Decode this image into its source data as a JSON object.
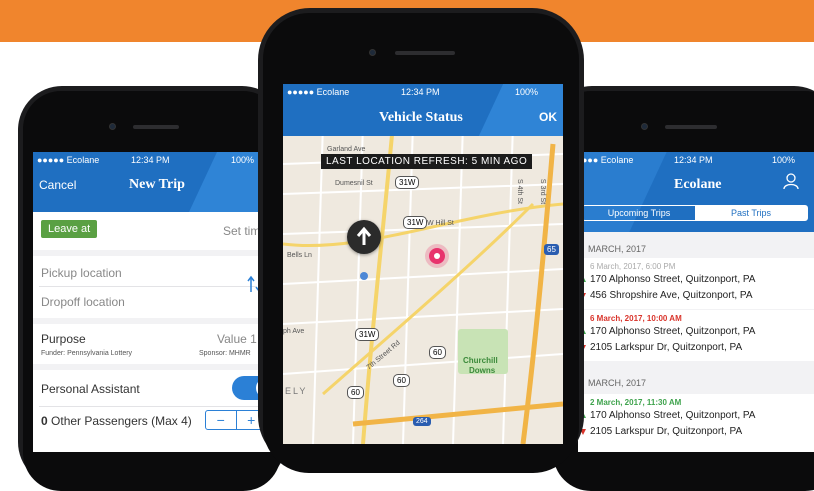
{
  "colors": {
    "banner": "#f0852d",
    "navbar": "#1f6fc1",
    "accent_green": "#5aa043",
    "toggle": "#2b80d6",
    "date_red": "#d9342b",
    "date_green": "#3fa34d"
  },
  "left_phone": {
    "status": {
      "carrier": "●●●●● Ecolane",
      "time": "12:34 PM",
      "battery": "100%"
    },
    "nav": {
      "cancel": "Cancel",
      "title": "New Trip"
    },
    "leave_at": "Leave at",
    "set_time": "Set time",
    "pickup": "Pickup location",
    "dropoff": "Dropoff location",
    "purpose_label": "Purpose",
    "purpose_value": "Value 1",
    "funder": "Funder: Pennsylvania Lottery",
    "sponsor": "Sponsor: MHMR",
    "personal_assistant": "Personal Assistant",
    "passengers_count": "0",
    "passengers_label": "Other Passengers (Max 4)",
    "minus": "−",
    "plus": "+",
    "swap_icon": "swap-arrows-icon"
  },
  "center_phone": {
    "status": {
      "carrier": "●●●●● Ecolane",
      "time": "12:34 PM",
      "battery": "100%"
    },
    "nav": {
      "title": "Vehicle Status",
      "ok": "OK"
    },
    "refresh": "LAST LOCATION REFRESH: 5 MIN AGO",
    "map_labels": {
      "garland": "Garland Ave",
      "dumesnil": "Dumesnil St",
      "whill": "W Hill St",
      "bells": "Bells Ln",
      "ph_ave": "ph Ave",
      "seventh": "7th Street Rd",
      "churchill": "Churchill",
      "downs": "Downs",
      "ely": "ELY",
      "s4th": "S 4th St",
      "s3rd": "S 3rd St"
    },
    "shields": {
      "r31w_a": "31W",
      "r31w_b": "31W",
      "r31w_c": "31W",
      "r60_a": "60",
      "r60_b": "60",
      "r60_c": "60",
      "i65": "65",
      "i264": "264"
    }
  },
  "right_phone": {
    "status": {
      "carrier": "●●● Ecolane",
      "time": "12:34 PM",
      "battery": "100%"
    },
    "nav": {
      "title": "Ecolane",
      "user_icon": "user-icon"
    },
    "tabs": {
      "upcoming": "Upcoming Trips",
      "past": "Past Trips"
    },
    "section1": "MARCH, 2017",
    "section2": "MARCH, 2017",
    "trips": [
      {
        "date": "6 March, 2017, 6:00 PM",
        "from": "170 Alphonso Street, Quitzonport, PA",
        "to": "456 Shropshire Ave, Quitzonport, PA"
      },
      {
        "date": "6 March, 2017, 10:00 AM",
        "from": "170 Alphonso Street, Quitzonport, PA",
        "to": "2105 Larkspur Dr, Quitzonport, PA"
      },
      {
        "date": "2 March, 2017, 11:30 AM",
        "from": "170 Alphonso Street, Quitzonport, PA",
        "to": "2105 Larkspur Dr, Quitzonport, PA"
      }
    ]
  }
}
